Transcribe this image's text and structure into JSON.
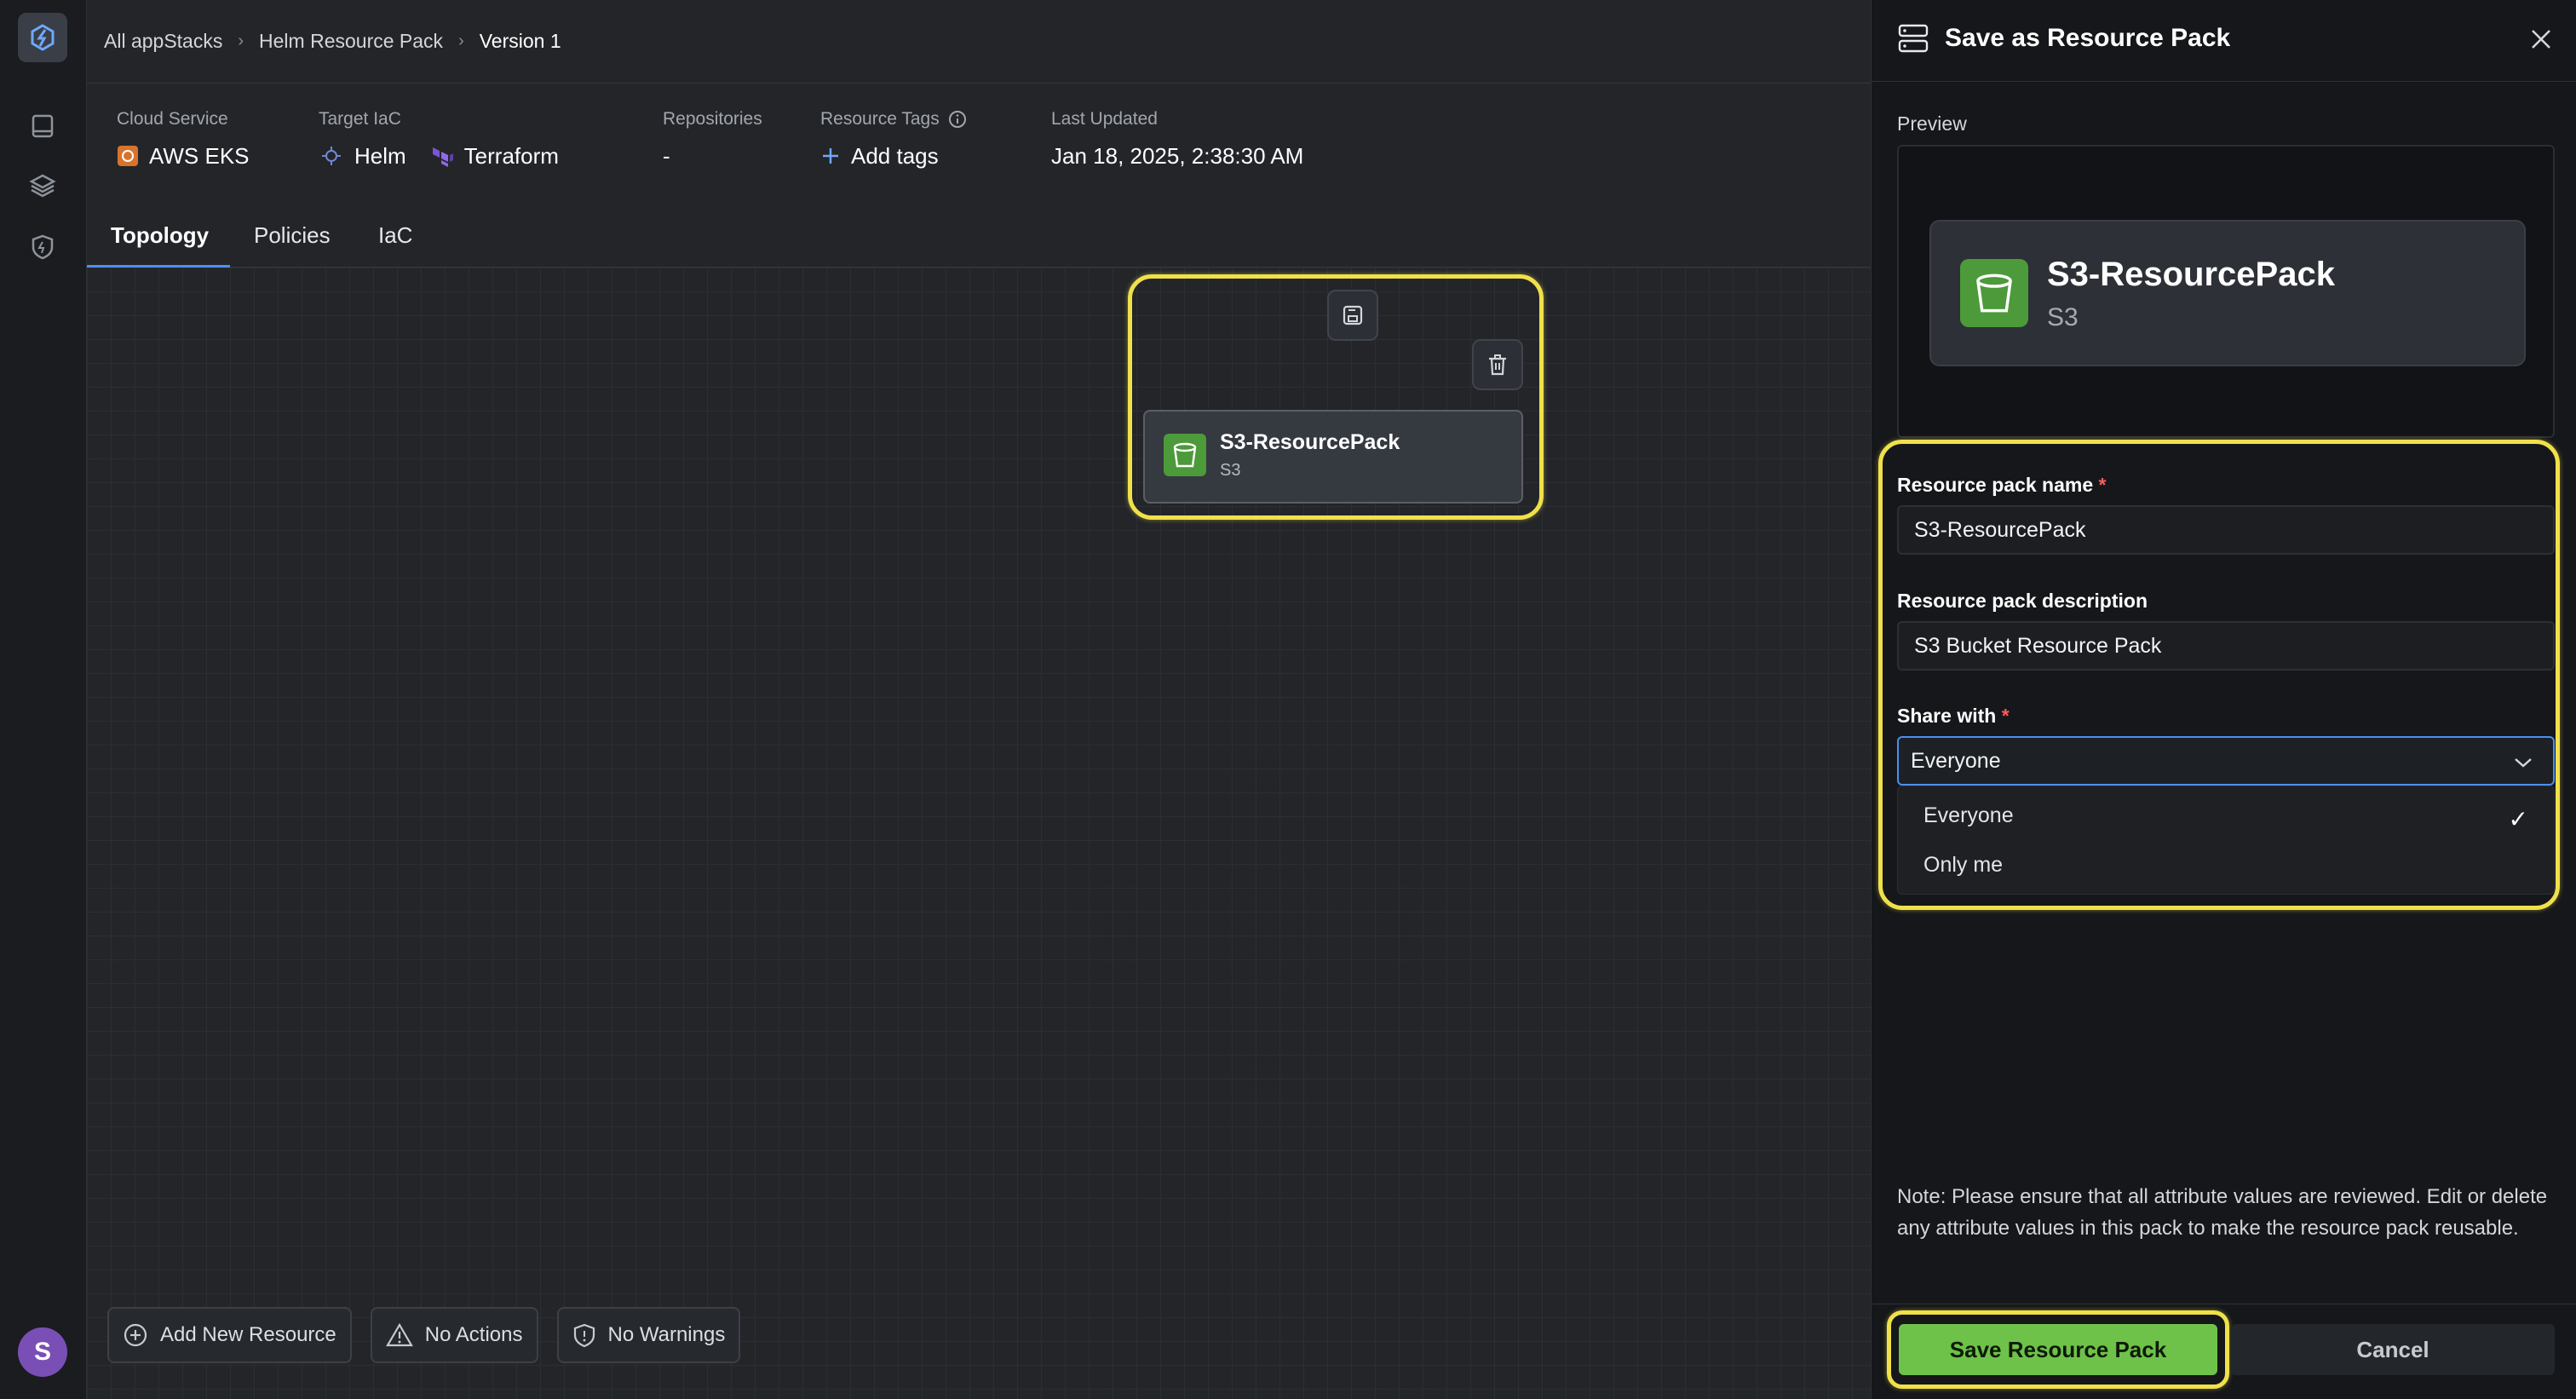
{
  "breadcrumb": [
    "All appStacks",
    "Helm Resource Pack",
    "Version 1"
  ],
  "meta": {
    "cloud_service": {
      "label": "Cloud Service",
      "value": "AWS EKS"
    },
    "target_iac": {
      "label": "Target IaC",
      "values": [
        "Helm",
        "Terraform"
      ]
    },
    "repositories": {
      "label": "Repositories",
      "value": "-"
    },
    "resource_tags": {
      "label": "Resource Tags",
      "action": "Add tags"
    },
    "last_updated": {
      "label": "Last Updated",
      "value": "Jan 18, 2025, 2:38:30 AM"
    }
  },
  "tabs": [
    "Topology",
    "Policies",
    "IaC"
  ],
  "active_tab": "Topology",
  "node": {
    "title": "S3-ResourcePack",
    "subtitle": "S3"
  },
  "bottom_actions": [
    "Add New Resource",
    "No Actions",
    "No Warnings"
  ],
  "avatar_initial": "S",
  "panel": {
    "title": "Save as Resource Pack",
    "preview_label": "Preview",
    "preview": {
      "title": "S3-ResourcePack",
      "subtitle": "S3"
    },
    "name_label": "Resource pack name",
    "name_value": "S3-ResourcePack",
    "desc_label": "Resource pack description",
    "desc_value": "S3 Bucket Resource Pack",
    "share_label": "Share with",
    "share_value": "Everyone",
    "share_options": [
      "Everyone",
      "Only me"
    ],
    "required_mark": "*",
    "note": "Note: Please ensure that all attribute values are reviewed. Edit or delete any attribute values in this pack to make the resource pack reusable.",
    "save_label": "Save Resource Pack",
    "cancel_label": "Cancel"
  },
  "colors": {
    "accent": "#4b8ff0",
    "highlight": "#f0e04a",
    "save": "#6ec24a",
    "s3": "#4c9a3a"
  }
}
